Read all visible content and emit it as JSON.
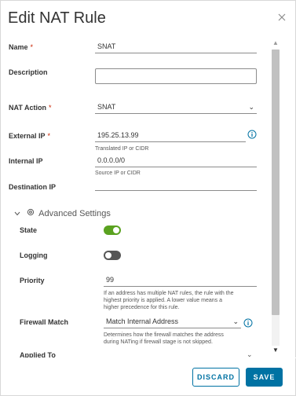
{
  "dialog": {
    "title": "Edit NAT Rule",
    "close_label": "×"
  },
  "form": {
    "name": {
      "label": "Name",
      "required": "*",
      "value": "SNAT"
    },
    "description": {
      "label": "Description",
      "value": ""
    },
    "nat_action": {
      "label": "NAT Action",
      "required": "*",
      "selected": "SNAT"
    },
    "external_ip": {
      "label": "External IP",
      "required": "*",
      "value": "195.25.13.99",
      "helper": "Translated IP or CIDR"
    },
    "internal_ip": {
      "label": "Internal IP",
      "value": "0.0.0.0/0",
      "helper": "Source IP or CIDR"
    },
    "destination_ip": {
      "label": "Destination IP",
      "value": ""
    }
  },
  "advanced": {
    "label": "Advanced Settings",
    "state": {
      "label": "State",
      "on": true
    },
    "logging": {
      "label": "Logging",
      "on": false
    },
    "priority": {
      "label": "Priority",
      "value": "99",
      "helper_lines": [
        "If an address has multiple NAT rules, the rule with the",
        "highest priority is applied. A lower value means a",
        "higher precedence for this rule."
      ]
    },
    "firewall_match": {
      "label": "Firewall Match",
      "selected": "Match Internal Address",
      "helper_lines": [
        "Determines how the firewall matches the address",
        "during NATing if firewall stage is not skipped."
      ]
    },
    "applied_to": {
      "label": "Applied To"
    }
  },
  "footer": {
    "discard_label": "DISCARD",
    "save_label": "SAVE"
  },
  "colors": {
    "primary": "#0072a3",
    "toggle_on": "#5aa220",
    "toggle_off": "#565656",
    "required": "#c92100"
  },
  "icons": [
    "close-icon",
    "info-icon",
    "chevron-down-icon",
    "gear-icon",
    "scroll-up-icon",
    "scroll-down-icon"
  ]
}
